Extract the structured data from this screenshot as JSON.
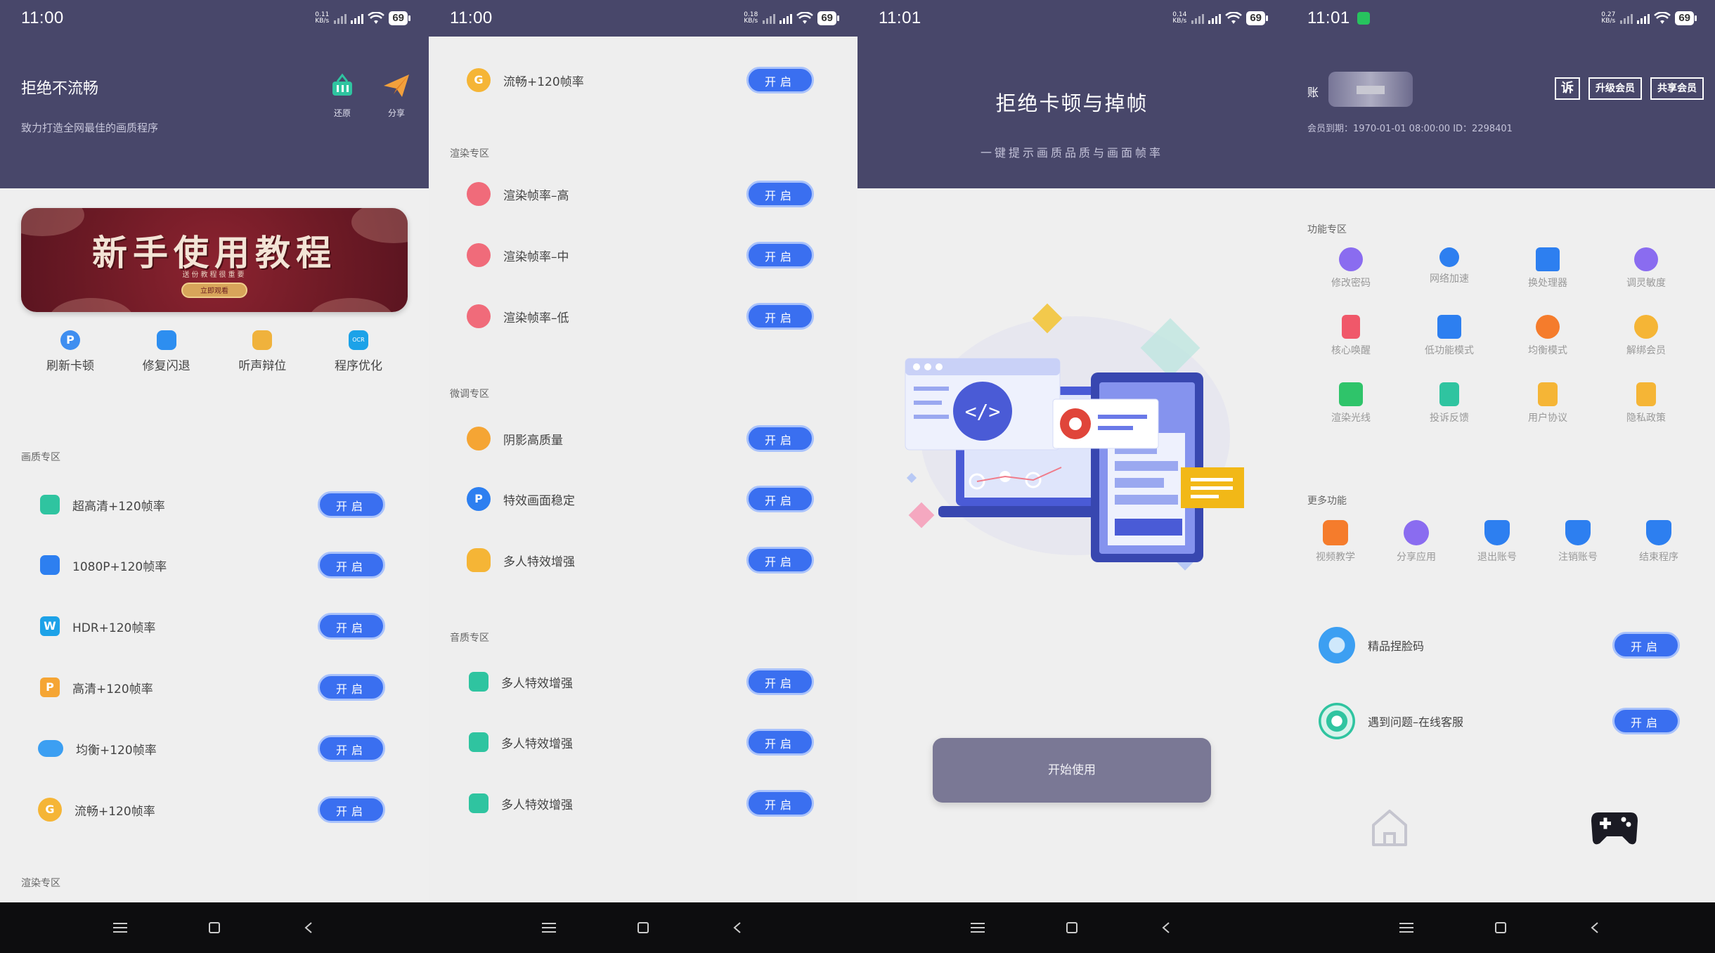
{
  "screen1": {
    "status": {
      "time": "11:00",
      "net_top": "0.11",
      "net_unit": "KB/s",
      "battery": "69"
    },
    "title": "拒绝不流畅",
    "subtitle": "致力打造全网最佳的画质程序",
    "header_actions": [
      {
        "label": "还原",
        "icon": "restore-basket-icon",
        "color": "#2fc4a0"
      },
      {
        "label": "分享",
        "icon": "paper-plane-icon",
        "color": "#f2a03c"
      }
    ],
    "banner": {
      "title": "新手使用教程",
      "subtitle": "送份教程很重要",
      "button": "立即观看"
    },
    "quick_actions": [
      {
        "label": "刷新卡顿",
        "icon": "refresh-p-icon",
        "color": "#3f8ef0"
      },
      {
        "label": "修复闪退",
        "icon": "repair-stack-icon",
        "color": "#2d8ef0"
      },
      {
        "label": "听声辩位",
        "icon": "gift-icon",
        "color": "#f0b23c"
      },
      {
        "label": "程序优化",
        "icon": "ocr-icon",
        "color": "#1ca2e8"
      }
    ],
    "section_quality": "画质专区",
    "quality_items": [
      {
        "label": "超高清+120帧率",
        "icon": "teal-cube-icon",
        "color": "#2fc4a0"
      },
      {
        "label": "1080P+120帧率",
        "icon": "blue-layers-icon",
        "color": "#2d7ff0"
      },
      {
        "label": "HDR+120帧率",
        "icon": "w-badge-icon",
        "color": "#1da2e8"
      },
      {
        "label": "高清+120帧率",
        "icon": "p-badge-icon",
        "color": "#f5a534"
      },
      {
        "label": "均衡+120帧率",
        "icon": "cloud-icon",
        "color": "#3c9ff2"
      },
      {
        "label": "流畅+120帧率",
        "icon": "g-coin-icon",
        "color": "#f5b536"
      }
    ],
    "open_label": "开启",
    "section_render": "渲染专区"
  },
  "screen2": {
    "status": {
      "time": "11:00",
      "net_top": "0.18",
      "net_unit": "KB/s",
      "battery": "69"
    },
    "top_item": {
      "label": "流畅+120帧率",
      "icon": "g-coin-icon",
      "color": "#f5b536"
    },
    "section_render": "渲染专区",
    "render_items": [
      {
        "label": "渲染帧率–高",
        "icon": "pink-eye-icon",
        "color": "#f06b7a"
      },
      {
        "label": "渲染帧率–中",
        "icon": "pink-eye-icon",
        "color": "#f06b7a"
      },
      {
        "label": "渲染帧率–低",
        "icon": "pink-eye-icon",
        "color": "#f06b7a"
      }
    ],
    "section_tune": "微调专区",
    "tune_items": [
      {
        "label": "阴影高质量",
        "icon": "orange-cloud-icon",
        "color": "#f5a534"
      },
      {
        "label": "特效画面稳定",
        "icon": "blue-p-icon",
        "color": "#2d7ff0"
      },
      {
        "label": "多人特效增强",
        "icon": "sun-cloud-icon",
        "color": "#f5b536"
      }
    ],
    "section_audio": "音质专区",
    "audio_items": [
      {
        "label": "多人特效增强",
        "icon": "teal-cube-icon",
        "color": "#2fc4a0"
      },
      {
        "label": "多人特效增强",
        "icon": "teal-cube-icon",
        "color": "#2fc4a0"
      },
      {
        "label": "多人特效增强",
        "icon": "teal-cube-icon",
        "color": "#2fc4a0"
      }
    ],
    "open_label": "开启"
  },
  "screen3": {
    "status": {
      "time": "11:01",
      "net_top": "0.14",
      "net_unit": "KB/s",
      "battery": "69"
    },
    "title": "拒绝卡顿与掉帧",
    "subtitle": "一键提示画质品质与画面帧率",
    "start_button": "开始使用"
  },
  "screen4": {
    "status": {
      "time": "11:01",
      "net_top": "0.27",
      "net_unit": "KB/s",
      "battery": "69"
    },
    "account_label": "账",
    "expiry": "会员到期：1970-01-01 08:00:00  ID：2298401",
    "header_buttons": {
      "complain": "诉",
      "upgrade": "升级会员",
      "share": "共享会员"
    },
    "section_features": "功能专区",
    "features": [
      {
        "label": "修改密码",
        "icon": "lock-user-icon",
        "color": "#8a6cf0"
      },
      {
        "label": "网络加速",
        "icon": "compass-icon",
        "color": "#2d7ff0"
      },
      {
        "label": "换处理器",
        "icon": "cpu-house-icon",
        "color": "#2d7ff0"
      },
      {
        "label": "调灵敏度",
        "icon": "person-icon",
        "color": "#8a6cf0"
      },
      {
        "label": "核心唤醒",
        "icon": "phone-icon",
        "color": "#f0586a"
      },
      {
        "label": "低功能模式",
        "icon": "folder-icon",
        "color": "#2d7ff0"
      },
      {
        "label": "均衡模式",
        "icon": "fox-icon",
        "color": "#f57c2c"
      },
      {
        "label": "解绑会员",
        "icon": "coin-icon",
        "color": "#f5b536"
      },
      {
        "label": "渲染光线",
        "icon": "plus-box-icon",
        "color": "#2fc46a"
      },
      {
        "label": "投诉反馈",
        "icon": "doc-person-icon",
        "color": "#2fc4a0"
      },
      {
        "label": "用户协议",
        "icon": "doc-lock-icon",
        "color": "#f5b536"
      },
      {
        "label": "隐私政策",
        "icon": "doc-lock-icon",
        "color": "#f5b536"
      }
    ],
    "section_more": "更多功能",
    "more": [
      {
        "label": "视频教学",
        "icon": "play-icon",
        "color": "#f57c2c"
      },
      {
        "label": "分享应用",
        "icon": "person-star-icon",
        "color": "#8a6cf0"
      },
      {
        "label": "退出账号",
        "icon": "shield-star-icon",
        "color": "#2d7ff0"
      },
      {
        "label": "注销账号",
        "icon": "shield-star-icon",
        "color": "#2d7ff0"
      },
      {
        "label": "结束程序",
        "icon": "shield-star-icon",
        "color": "#2d7ff0"
      }
    ],
    "big_rows": [
      {
        "label": "精品捏脸码",
        "icon": "wheel-icon",
        "color": "#3c9ff2"
      },
      {
        "label": "遇到问题–在线客服",
        "icon": "target-icon",
        "color": "#2fc4a0"
      }
    ],
    "open_label": "开启",
    "tabs": [
      {
        "name": "home-icon"
      },
      {
        "name": "gamepad-icon"
      }
    ]
  }
}
